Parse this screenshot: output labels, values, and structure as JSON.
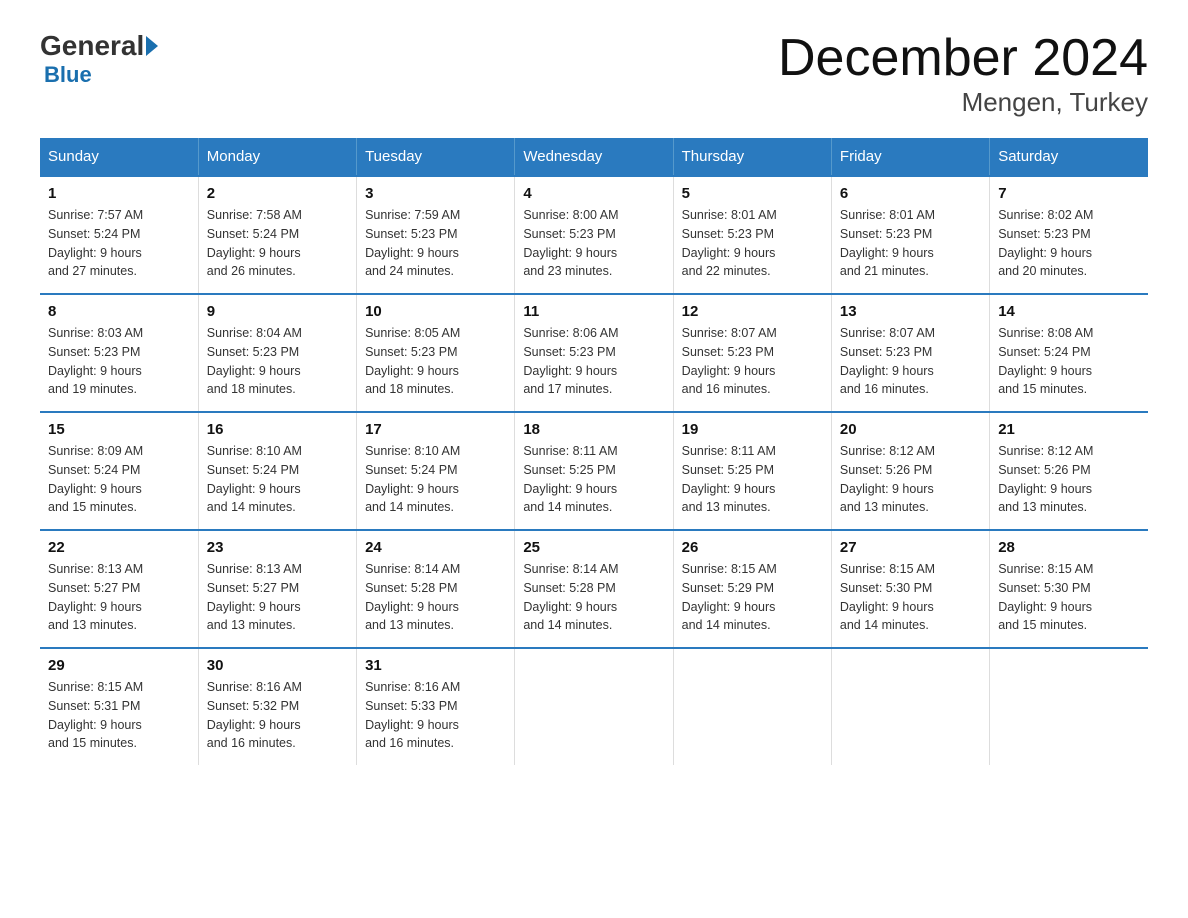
{
  "logo": {
    "general": "General",
    "blue": "Blue"
  },
  "title": "December 2024",
  "subtitle": "Mengen, Turkey",
  "headers": [
    "Sunday",
    "Monday",
    "Tuesday",
    "Wednesday",
    "Thursday",
    "Friday",
    "Saturday"
  ],
  "weeks": [
    [
      {
        "day": "1",
        "info": "Sunrise: 7:57 AM\nSunset: 5:24 PM\nDaylight: 9 hours\nand 27 minutes."
      },
      {
        "day": "2",
        "info": "Sunrise: 7:58 AM\nSunset: 5:24 PM\nDaylight: 9 hours\nand 26 minutes."
      },
      {
        "day": "3",
        "info": "Sunrise: 7:59 AM\nSunset: 5:23 PM\nDaylight: 9 hours\nand 24 minutes."
      },
      {
        "day": "4",
        "info": "Sunrise: 8:00 AM\nSunset: 5:23 PM\nDaylight: 9 hours\nand 23 minutes."
      },
      {
        "day": "5",
        "info": "Sunrise: 8:01 AM\nSunset: 5:23 PM\nDaylight: 9 hours\nand 22 minutes."
      },
      {
        "day": "6",
        "info": "Sunrise: 8:01 AM\nSunset: 5:23 PM\nDaylight: 9 hours\nand 21 minutes."
      },
      {
        "day": "7",
        "info": "Sunrise: 8:02 AM\nSunset: 5:23 PM\nDaylight: 9 hours\nand 20 minutes."
      }
    ],
    [
      {
        "day": "8",
        "info": "Sunrise: 8:03 AM\nSunset: 5:23 PM\nDaylight: 9 hours\nand 19 minutes."
      },
      {
        "day": "9",
        "info": "Sunrise: 8:04 AM\nSunset: 5:23 PM\nDaylight: 9 hours\nand 18 minutes."
      },
      {
        "day": "10",
        "info": "Sunrise: 8:05 AM\nSunset: 5:23 PM\nDaylight: 9 hours\nand 18 minutes."
      },
      {
        "day": "11",
        "info": "Sunrise: 8:06 AM\nSunset: 5:23 PM\nDaylight: 9 hours\nand 17 minutes."
      },
      {
        "day": "12",
        "info": "Sunrise: 8:07 AM\nSunset: 5:23 PM\nDaylight: 9 hours\nand 16 minutes."
      },
      {
        "day": "13",
        "info": "Sunrise: 8:07 AM\nSunset: 5:23 PM\nDaylight: 9 hours\nand 16 minutes."
      },
      {
        "day": "14",
        "info": "Sunrise: 8:08 AM\nSunset: 5:24 PM\nDaylight: 9 hours\nand 15 minutes."
      }
    ],
    [
      {
        "day": "15",
        "info": "Sunrise: 8:09 AM\nSunset: 5:24 PM\nDaylight: 9 hours\nand 15 minutes."
      },
      {
        "day": "16",
        "info": "Sunrise: 8:10 AM\nSunset: 5:24 PM\nDaylight: 9 hours\nand 14 minutes."
      },
      {
        "day": "17",
        "info": "Sunrise: 8:10 AM\nSunset: 5:24 PM\nDaylight: 9 hours\nand 14 minutes."
      },
      {
        "day": "18",
        "info": "Sunrise: 8:11 AM\nSunset: 5:25 PM\nDaylight: 9 hours\nand 14 minutes."
      },
      {
        "day": "19",
        "info": "Sunrise: 8:11 AM\nSunset: 5:25 PM\nDaylight: 9 hours\nand 13 minutes."
      },
      {
        "day": "20",
        "info": "Sunrise: 8:12 AM\nSunset: 5:26 PM\nDaylight: 9 hours\nand 13 minutes."
      },
      {
        "day": "21",
        "info": "Sunrise: 8:12 AM\nSunset: 5:26 PM\nDaylight: 9 hours\nand 13 minutes."
      }
    ],
    [
      {
        "day": "22",
        "info": "Sunrise: 8:13 AM\nSunset: 5:27 PM\nDaylight: 9 hours\nand 13 minutes."
      },
      {
        "day": "23",
        "info": "Sunrise: 8:13 AM\nSunset: 5:27 PM\nDaylight: 9 hours\nand 13 minutes."
      },
      {
        "day": "24",
        "info": "Sunrise: 8:14 AM\nSunset: 5:28 PM\nDaylight: 9 hours\nand 13 minutes."
      },
      {
        "day": "25",
        "info": "Sunrise: 8:14 AM\nSunset: 5:28 PM\nDaylight: 9 hours\nand 14 minutes."
      },
      {
        "day": "26",
        "info": "Sunrise: 8:15 AM\nSunset: 5:29 PM\nDaylight: 9 hours\nand 14 minutes."
      },
      {
        "day": "27",
        "info": "Sunrise: 8:15 AM\nSunset: 5:30 PM\nDaylight: 9 hours\nand 14 minutes."
      },
      {
        "day": "28",
        "info": "Sunrise: 8:15 AM\nSunset: 5:30 PM\nDaylight: 9 hours\nand 15 minutes."
      }
    ],
    [
      {
        "day": "29",
        "info": "Sunrise: 8:15 AM\nSunset: 5:31 PM\nDaylight: 9 hours\nand 15 minutes."
      },
      {
        "day": "30",
        "info": "Sunrise: 8:16 AM\nSunset: 5:32 PM\nDaylight: 9 hours\nand 16 minutes."
      },
      {
        "day": "31",
        "info": "Sunrise: 8:16 AM\nSunset: 5:33 PM\nDaylight: 9 hours\nand 16 minutes."
      },
      {
        "day": "",
        "info": ""
      },
      {
        "day": "",
        "info": ""
      },
      {
        "day": "",
        "info": ""
      },
      {
        "day": "",
        "info": ""
      }
    ]
  ]
}
